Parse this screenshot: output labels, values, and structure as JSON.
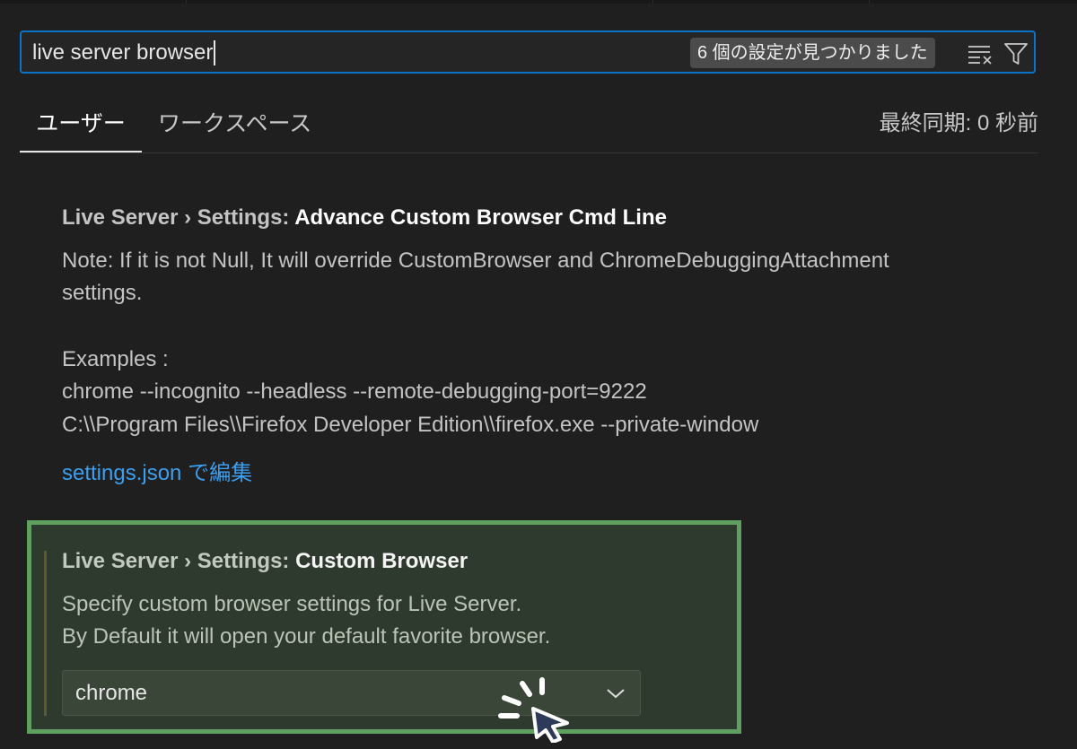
{
  "search": {
    "value": "live server browser",
    "result_count": "6 個の設定が見つかりました"
  },
  "tabs": {
    "user": "ユーザー",
    "workspace": "ワークスペース",
    "last_sync": "最終同期: 0 秒前"
  },
  "settings": [
    {
      "category": "Live Server › Settings: ",
      "name": "Advance Custom Browser Cmd Line",
      "description_lines": [
        "Note: If it is not Null, It will override CustomBrowser and ChromeDebuggingAttachment",
        "settings.",
        "",
        "Examples :",
        "chrome --incognito --headless --remote-debugging-port=9222",
        "C:\\\\Program Files\\\\Firefox Developer Edition\\\\firefox.exe --private-window"
      ],
      "edit_link": "settings.json で編集"
    },
    {
      "category": "Live Server › Settings: ",
      "name": "Custom Browser",
      "description_lines": [
        "Specify custom browser settings for Live Server.",
        "By Default it will open your default favorite browser."
      ],
      "selected_value": "chrome"
    }
  ],
  "icons": {
    "clear": "clear-filter-icon",
    "filter": "filter-icon",
    "dropdown": "chevron-down-icon",
    "cursor": "mouse-pointer-click-icon"
  },
  "colors": {
    "accent": "#0b74c8",
    "link": "#3b9ff0",
    "highlight_border": "#5fa060",
    "highlight_bg": "#2e3a2d"
  }
}
